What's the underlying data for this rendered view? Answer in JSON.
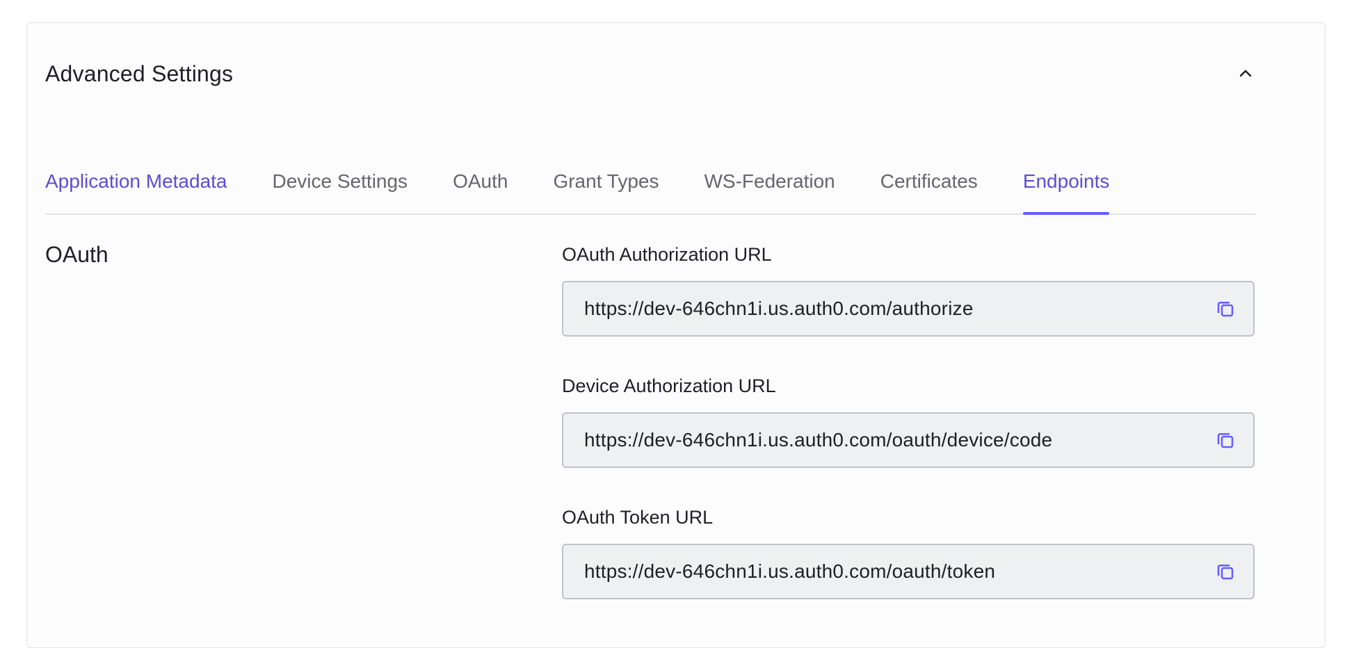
{
  "section": {
    "title": "Advanced Settings",
    "collapse_icon": "chevron-up-icon"
  },
  "tabs": [
    {
      "label": "Application Metadata",
      "state": "visited"
    },
    {
      "label": "Device Settings",
      "state": "default"
    },
    {
      "label": "OAuth",
      "state": "default"
    },
    {
      "label": "Grant Types",
      "state": "default"
    },
    {
      "label": "WS-Federation",
      "state": "default"
    },
    {
      "label": "Certificates",
      "state": "default"
    },
    {
      "label": "Endpoints",
      "state": "active"
    }
  ],
  "group": {
    "title": "OAuth"
  },
  "fields": [
    {
      "label": "OAuth Authorization URL",
      "value": "https://dev-646chn1i.us.auth0.com/authorize"
    },
    {
      "label": "Device Authorization URL",
      "value": "https://dev-646chn1i.us.auth0.com/oauth/device/code"
    },
    {
      "label": "OAuth Token URL",
      "value": "https://dev-646chn1i.us.auth0.com/oauth/token"
    }
  ],
  "colors": {
    "accent": "#635dff",
    "tab_link": "#5b4ed3",
    "text": "#1f1f24",
    "muted_text": "#65656c",
    "field_bg": "#eff0f2",
    "field_border": "#c2c2c8"
  }
}
